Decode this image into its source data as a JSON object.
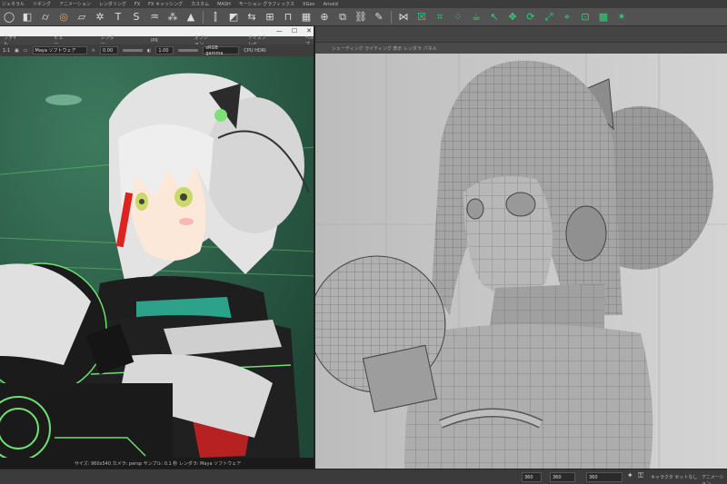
{
  "menubar": {
    "items": [
      "ジェネラル",
      "リギング",
      "アニメーション",
      "レンダリング",
      "FX",
      "FX キャッシング",
      "カスタム",
      "MASH",
      "モーション グラフィックス",
      "XGen",
      "Arnold"
    ]
  },
  "shelf": {
    "icons": [
      "sphere-icon",
      "cube-icon",
      "cylinder-icon",
      "torus-icon",
      "plane-icon",
      "gear-icon",
      "text-icon",
      "svg-icon",
      "cloth-icon",
      "cluster-icon",
      "cone-icon",
      "split-icon",
      "bevel-icon",
      "align-icon",
      "crossgrid-icon",
      "bridge-icon",
      "fill-icon",
      "append-icon",
      "extrude-icon",
      "chain-icon",
      "pen-icon",
      "merge-icon",
      "checkbox-icon",
      "lattice-icon",
      "dots-icon",
      "teapot-icon",
      "cursor-icon",
      "move-icon",
      "rotate-icon",
      "scale-icon",
      "pivot-icon",
      "snap-icon",
      "checker-icon",
      "star-icon"
    ]
  },
  "render_window": {
    "menu": [
      "ファイル",
      "ビュー",
      "レンダー",
      "IPR",
      "オプション",
      "ディスプレイ",
      "ヘルプ"
    ],
    "toolbar": {
      "ratio": "1:1",
      "view_transform": "Maya ソフトウェア",
      "exposure": "0.00",
      "gamma": "1.00",
      "color_space": "sRGB gamma",
      "display": "CPU HDRI"
    },
    "status": "サイズ: 960x540 カメラ: persp サンプル: 0.1 秒 レンダラ: Maya ソフトウェア"
  },
  "viewport": {
    "header": "シェーディング ライティング 表示 レンダラ パネル"
  },
  "timebar": {
    "start": "360",
    "end": "360",
    "range_start": "360",
    "range_end": "360",
    "char_set": "キャラクタ セットなし",
    "anim_layer": "アニメーション"
  },
  "colors": {
    "accent": "#2fcf7a",
    "render_bg": "#2f5e49",
    "neon": "#6ee06f",
    "viewport_bg": "#c7c7c7"
  }
}
